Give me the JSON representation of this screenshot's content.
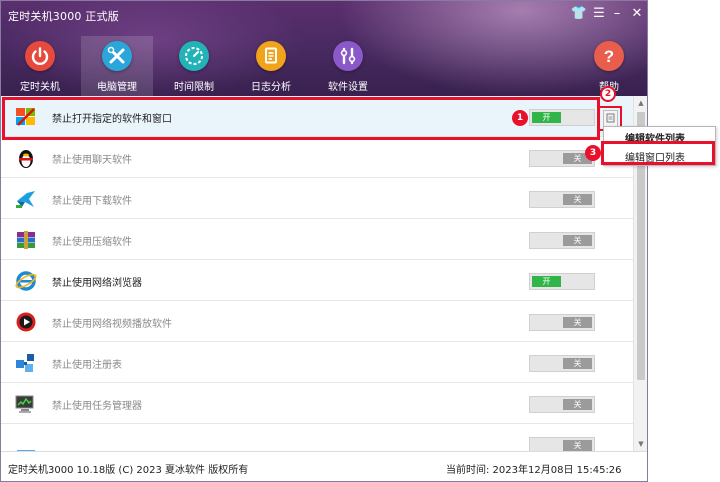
{
  "window": {
    "title": "定时关机3000 正式版",
    "controls": {
      "skin": "👕",
      "menu": "☰",
      "minimize": "–",
      "close": "✕"
    }
  },
  "nav": {
    "items": [
      {
        "label": "定时关机",
        "icon": "power-icon",
        "color": "#e54a3c",
        "active": false
      },
      {
        "label": "电脑管理",
        "icon": "tools-icon",
        "color": "#2ba6d8",
        "active": true
      },
      {
        "label": "时间限制",
        "icon": "timer-icon",
        "color": "#22b3b8",
        "active": false
      },
      {
        "label": "日志分析",
        "icon": "log-icon",
        "color": "#f0a31b",
        "active": false
      },
      {
        "label": "软件设置",
        "icon": "settings-icon",
        "color": "#8a58c8",
        "active": false
      }
    ],
    "help": {
      "label": "帮助",
      "icon": "help-icon",
      "color": "#e85d4c"
    }
  },
  "rows": [
    {
      "label": "禁止打开指定的软件和窗口",
      "icon": "windows-block-icon",
      "state": "开",
      "on": true,
      "selected": true
    },
    {
      "label": "禁止使用聊天软件",
      "icon": "qq-penguin-icon",
      "state": "关",
      "on": false
    },
    {
      "label": "禁止使用下载软件",
      "icon": "download-bird-icon",
      "state": "关",
      "on": false
    },
    {
      "label": "禁止使用压缩软件",
      "icon": "winrar-books-icon",
      "state": "关",
      "on": false
    },
    {
      "label": "禁止使用网络浏览器",
      "icon": "ie-browser-icon",
      "state": "开",
      "on": true
    },
    {
      "label": "禁止使用网络视频播放软件",
      "icon": "video-player-icon",
      "state": "关",
      "on": false
    },
    {
      "label": "禁止使用注册表",
      "icon": "registry-cubes-icon",
      "state": "关",
      "on": false
    },
    {
      "label": "禁止使用任务管理器",
      "icon": "task-manager-icon",
      "state": "关",
      "on": false
    },
    {
      "label": "",
      "icon": "partial-row-icon",
      "state": "关",
      "on": false
    }
  ],
  "context_menu": {
    "items": [
      "编辑软件列表",
      "编辑窗口列表"
    ]
  },
  "badges": [
    "1",
    "2",
    "3"
  ],
  "status": {
    "left": "定时关机3000  10.18版 (C) 2023   夏冰软件 版权所有",
    "right": "当前时间:  2023年12月08日 15:45:26"
  },
  "colors": {
    "highlight": "#e8102a",
    "toggle_on": "#32b548",
    "toggle_off": "#9b9b9b"
  }
}
